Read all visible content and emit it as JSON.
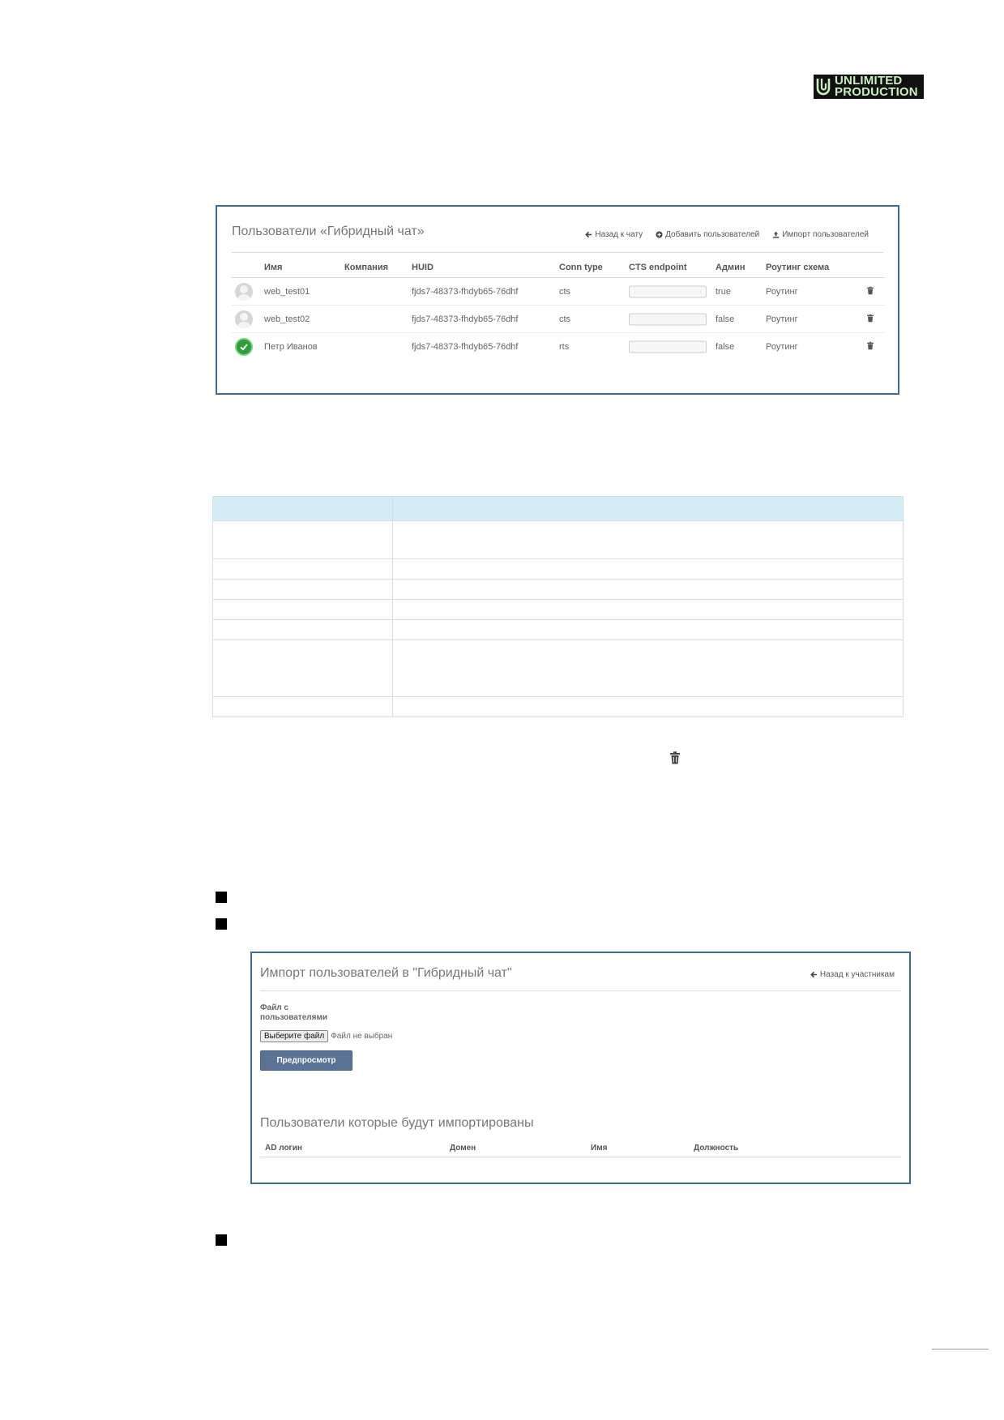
{
  "logo": {
    "line1": "UNLIMITED",
    "line2": "PRODUCTION",
    "icon": "ub-logo-icon"
  },
  "users_panel": {
    "title": "Пользователи «Гибридный чат»",
    "actions": [
      {
        "label": "Назад к чату",
        "icon": "arrow-left-icon"
      },
      {
        "label": "Добавить пользователей",
        "icon": "plus-circle-icon"
      },
      {
        "label": "Импорт пользователей",
        "icon": "upload-icon"
      }
    ],
    "columns": {
      "name": "Имя",
      "company": "Компания",
      "huid": "HUID",
      "conn_type": "Conn type",
      "cts_endpoint": "CTS endpoint",
      "admin": "Админ",
      "routing": "Роутинг схема"
    },
    "rows": [
      {
        "avatar": "default-avatar-icon",
        "name": "web_test01",
        "company": "",
        "huid": "fjds7-48373-fhdyb65-76dhf",
        "conn_type": "cts",
        "cts_endpoint": "",
        "admin": "true",
        "routing": "Роутинг"
      },
      {
        "avatar": "default-avatar-icon",
        "name": "web_test02",
        "company": "",
        "huid": "fjds7-48373-fhdyb65-76dhf",
        "conn_type": "cts",
        "cts_endpoint": "",
        "admin": "false",
        "routing": "Роутинг"
      },
      {
        "avatar": "verified-avatar-icon",
        "name": "Петр Иванов",
        "company": "",
        "huid": "fjds7-48373-fhdyb65-76dhf",
        "conn_type": "rts",
        "cts_endpoint": "",
        "admin": "false",
        "routing": "Роутинг"
      }
    ]
  },
  "description_table": {
    "header": [
      "",
      ""
    ],
    "rows": [
      [
        "",
        ""
      ],
      [
        "",
        ""
      ],
      [
        "",
        ""
      ],
      [
        "",
        ""
      ],
      [
        "",
        ""
      ],
      [
        "",
        ""
      ],
      [
        "",
        ""
      ]
    ]
  },
  "import_panel": {
    "title": "Импорт пользователей в \"Гибридный чат\"",
    "back_label": "Назад к участникам",
    "file_label": "Файл с пользователями",
    "choose_file_label": "Выберите файл",
    "no_file_text": "Файл не выбран",
    "preview_label": "Предпросмотр",
    "subtitle": "Пользователи которые будут импортированы",
    "columns": {
      "ad_login": "AD логин",
      "domain": "Домен",
      "name": "Имя",
      "position": "Должность"
    }
  },
  "colors": {
    "panel_border": "#3f6a96",
    "table_header": "#d4ecf6",
    "button": "#5a7395",
    "verified": "#2e9d3a"
  }
}
